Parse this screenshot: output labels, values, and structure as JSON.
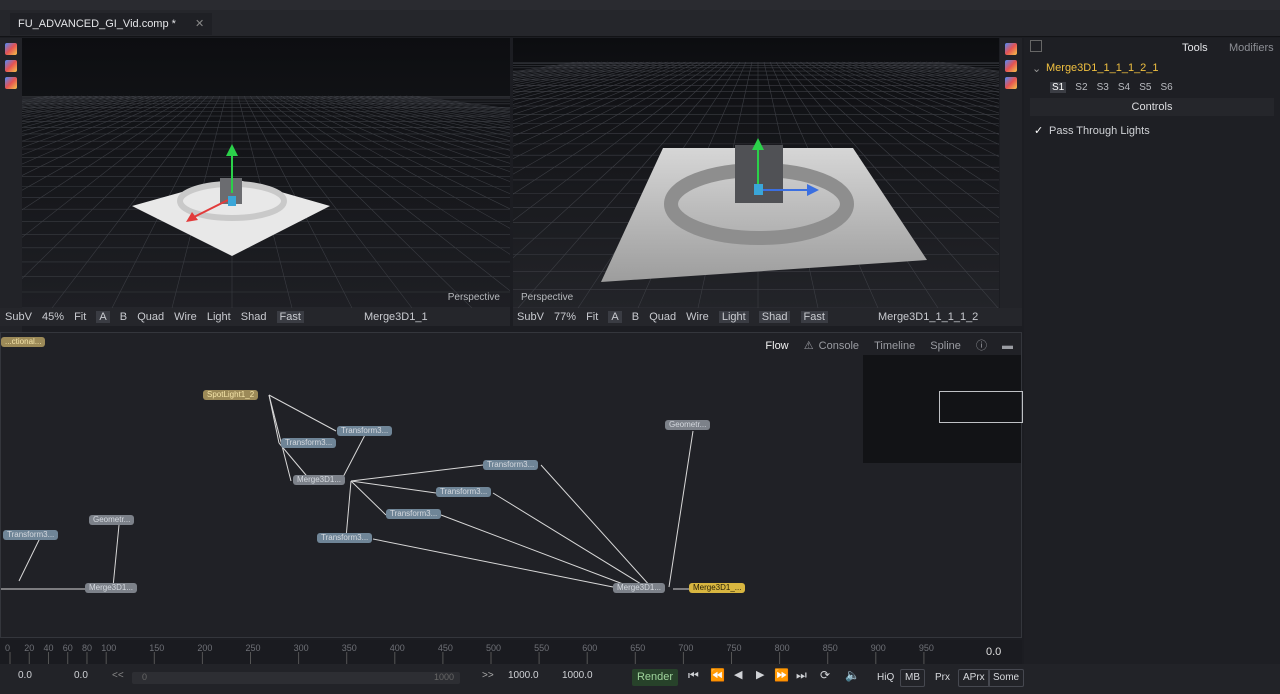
{
  "tab": {
    "title": "FU_ADVANCED_GI_Vid.comp *",
    "close": "✕"
  },
  "viewer1": {
    "label": "Perspective",
    "bar": {
      "subv": "SubV",
      "zoom": "45%",
      "fit": "Fit",
      "a": "A",
      "b": "B",
      "quad": "Quad",
      "wire": "Wire",
      "light": "Light",
      "shad": "Shad",
      "fast": "Fast",
      "node": "Merge3D1_1"
    }
  },
  "viewer2": {
    "label": "Perspective",
    "bar": {
      "subv": "SubV",
      "zoom": "77%",
      "fit": "Fit",
      "a": "A",
      "b": "B",
      "quad": "Quad",
      "wire": "Wire",
      "light": "Light",
      "shad": "Shad",
      "fast": "Fast",
      "node": "Merge3D1_1_1_1_2"
    }
  },
  "inspector": {
    "tabs": [
      "Tools",
      "Modifiers"
    ],
    "node_name": "Merge3D1_1_1_1_2_1",
    "slots": [
      "S1",
      "S2",
      "S3",
      "S4",
      "S5",
      "S6"
    ],
    "section": "Controls",
    "checkbox_label": "Pass Through Lights",
    "checkbox_checked": true
  },
  "flow": {
    "tabs": [
      "Flow",
      "Console",
      "Timeline",
      "Spline"
    ],
    "nodes": {
      "left_top": "...ctional...",
      "spotlight": "SpotLight1_2",
      "t1": "Transform3...",
      "t2": "Transform3...",
      "merge_a": "Merge3D1...",
      "t3": "Transform3...",
      "t4": "Transform3...",
      "t5": "Transform3...",
      "t6": "Transform3...",
      "geo_r": "Geometr...",
      "geo_l": "Geometr...",
      "t_left": "Transform3...",
      "merge_left": "Merge3D1...",
      "merge_b": "Merge3D1...",
      "merge_out": "Merge3D1_..."
    }
  },
  "ruler": {
    "ticks": [
      "0",
      "20",
      "40",
      "60",
      "80",
      "100",
      "150",
      "200",
      "250",
      "300",
      "350",
      "400",
      "450",
      "500",
      "550",
      "600",
      "650",
      "700",
      "750",
      "800",
      "850",
      "900",
      "950"
    ],
    "current": "0.0"
  },
  "transport": {
    "start": "0.0",
    "start2": "0.0",
    "rew": "<<",
    "range_start": "0",
    "range_end": "1000",
    "ff": ">>",
    "end": "1000.0",
    "end2": "1000.0",
    "render": "Render",
    "hiq": "HiQ",
    "mb": "MB",
    "prx": "Prx",
    "aprx": "APrx",
    "some": "Some"
  }
}
